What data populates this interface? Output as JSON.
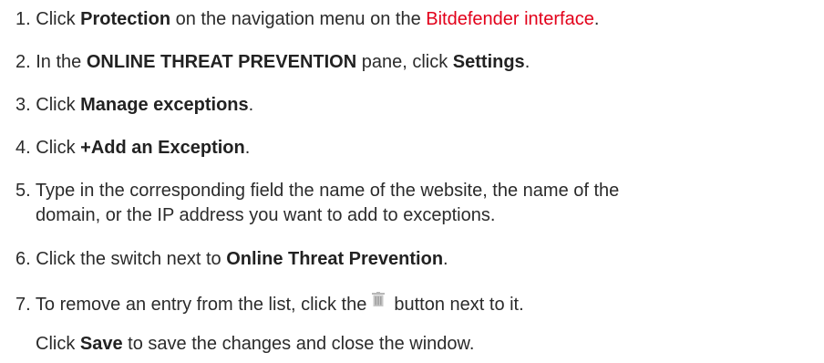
{
  "steps": [
    {
      "num": "1.",
      "pre": "Click ",
      "bold": "Protection",
      "mid": " on the navigation menu on the ",
      "link": "Bitdefender interface",
      "post": "."
    },
    {
      "num": "2.",
      "pre": "In the ",
      "bold1": "ONLINE THREAT PREVENTION",
      "mid": " pane, click ",
      "bold2": "Settings",
      "post": "."
    },
    {
      "num": "3.",
      "pre": "Click ",
      "bold": "Manage exceptions",
      "post": "."
    },
    {
      "num": "4.",
      "pre": "Click ",
      "bold": "+Add an Exception",
      "post": "."
    },
    {
      "num": "5.",
      "line1": "Type in the corresponding field the name of the website, the name of the",
      "line2": "domain, or the IP address you want to add to exceptions."
    },
    {
      "num": "6.",
      "pre": "Click the switch next to ",
      "bold": "Online Threat Prevention",
      "post": "."
    },
    {
      "num": "7.",
      "pre": "To remove an entry from the list, click the",
      "icon": "trash-icon",
      "post": "button next to it."
    }
  ],
  "final": {
    "pre": "Click ",
    "bold": "Save",
    "post": " to save the changes and close the window."
  },
  "colors": {
    "text": "#2b2b2b",
    "link": "#e2001a",
    "icon": "#b8b8b8"
  }
}
